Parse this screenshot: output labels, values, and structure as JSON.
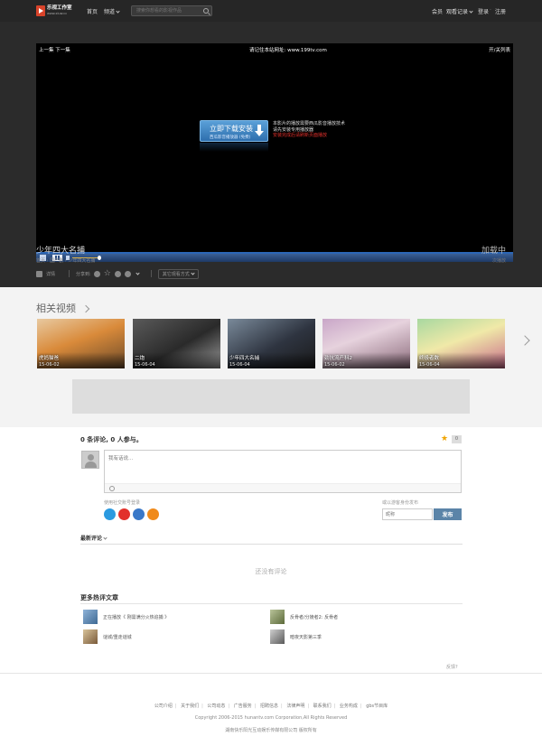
{
  "site": {
    "logo_name": "乐视工作室",
    "logo_sub": "www.xiuw.cc",
    "nav_home": "首页",
    "nav_channel": "频道",
    "search_placeholder": "搜索你想看的影视作品",
    "nav_member": "会员",
    "nav_history": "观看记录",
    "nav_login": "登录",
    "nav_separator": "·",
    "nav_register": "注册"
  },
  "player": {
    "prev_next": "上一集 下一集",
    "notice": "请记住本站网址: www.199tv.com",
    "toggle_list": "开/关列表",
    "download_title": "立即下载安装",
    "download_sub": "西瓜影音播放器 (免费)",
    "msg_line1": "本影片的播放需要西瓜影音播放技术",
    "msg_line2": "请先安装专用播放器",
    "msg_line3": "安装完成后请刷新页面播放",
    "volume_level": 0.75
  },
  "video": {
    "title": "少年四大名捕",
    "breadcrumb": "首页 › 国产剧 › 少年四大名捕",
    "status": "加载中",
    "play_count": "次播放",
    "detail_label": "详情",
    "share_label": "分享到:",
    "play_mode": "其它观看方式"
  },
  "related": {
    "heading": "相关视频",
    "items": [
      {
        "title": "虎妈猫爸",
        "date": "15-06-02",
        "bg": "linear-gradient(160deg,#e8c9a0 0%,#d98a3a 45%,#6b4a2a 100%)"
      },
      {
        "title": "二炮",
        "date": "15-06-04",
        "bg": "linear-gradient(150deg,#5a5a5a 0%,#2a2a2a 55%,#9a9a9a 100%)"
      },
      {
        "title": "少年四大名捕",
        "date": "15-06-04",
        "bg": "linear-gradient(150deg,#7a8a9a 0%,#2e3440 55%,#1a1a1a 100%)"
      },
      {
        "title": "劲抗流产科2",
        "date": "15-06-02",
        "bg": "linear-gradient(160deg,#c9a6c8 0%,#e6d2dd 40%,#8a6a7a 100%)"
      },
      {
        "title": "终极者数",
        "date": "15-06-04",
        "bg": "linear-gradient(160deg,#a8d8a0 0%,#f0e9a8 45%,#c86a8a 100%)"
      }
    ]
  },
  "comments": {
    "header": "0 条评论, 0 人参与。",
    "star_count": "0",
    "placeholder": "我有话说...",
    "social_label": "使用社交账号登录",
    "guest_label": "或以游客身份发布",
    "nickname_placeholder": "昵称",
    "publish_label": "发布",
    "latest_label": "最新评论",
    "empty": "还没有评论",
    "hot_heading": "更多热评文章",
    "hot_items": [
      {
        "title": "正在播放《 刚需满分火热追捕 》",
        "thumb": "linear-gradient(135deg,#8fb3d8,#3f6a94)"
      },
      {
        "title": "反骨者/分娩者2: 反骨者",
        "thumb": "linear-gradient(135deg,#b9c49a,#5c6a3a)"
      },
      {
        "title": "谜城/重走谜城",
        "thumb": "linear-gradient(135deg,#d8c39a,#7a5a3a)"
      },
      {
        "title": "暗夜天影第三季",
        "thumb": "linear-gradient(135deg,#cfcfcf,#5a5a5a)"
      }
    ],
    "feedback": "反馈?"
  },
  "footer": {
    "links": [
      "公司介绍",
      "关于我们",
      "公司动态",
      "广告服务",
      "招聘信息",
      "法律声明",
      "联系我们",
      "业务构成",
      "gbs节目库"
    ],
    "link_separator": "|",
    "copyright": "Copyright 2006-2015 hunantv.com Corporation,All Rights Reserved",
    "company": "湖南快乐阳光互动娱乐传媒有限公司 版权所有"
  },
  "colors": {
    "topbar": "#262626",
    "dark_bg": "#2b2b2b",
    "player_controls": "#1e3a66",
    "accent_blue": "#5b84a8",
    "star": "#f0a400"
  }
}
